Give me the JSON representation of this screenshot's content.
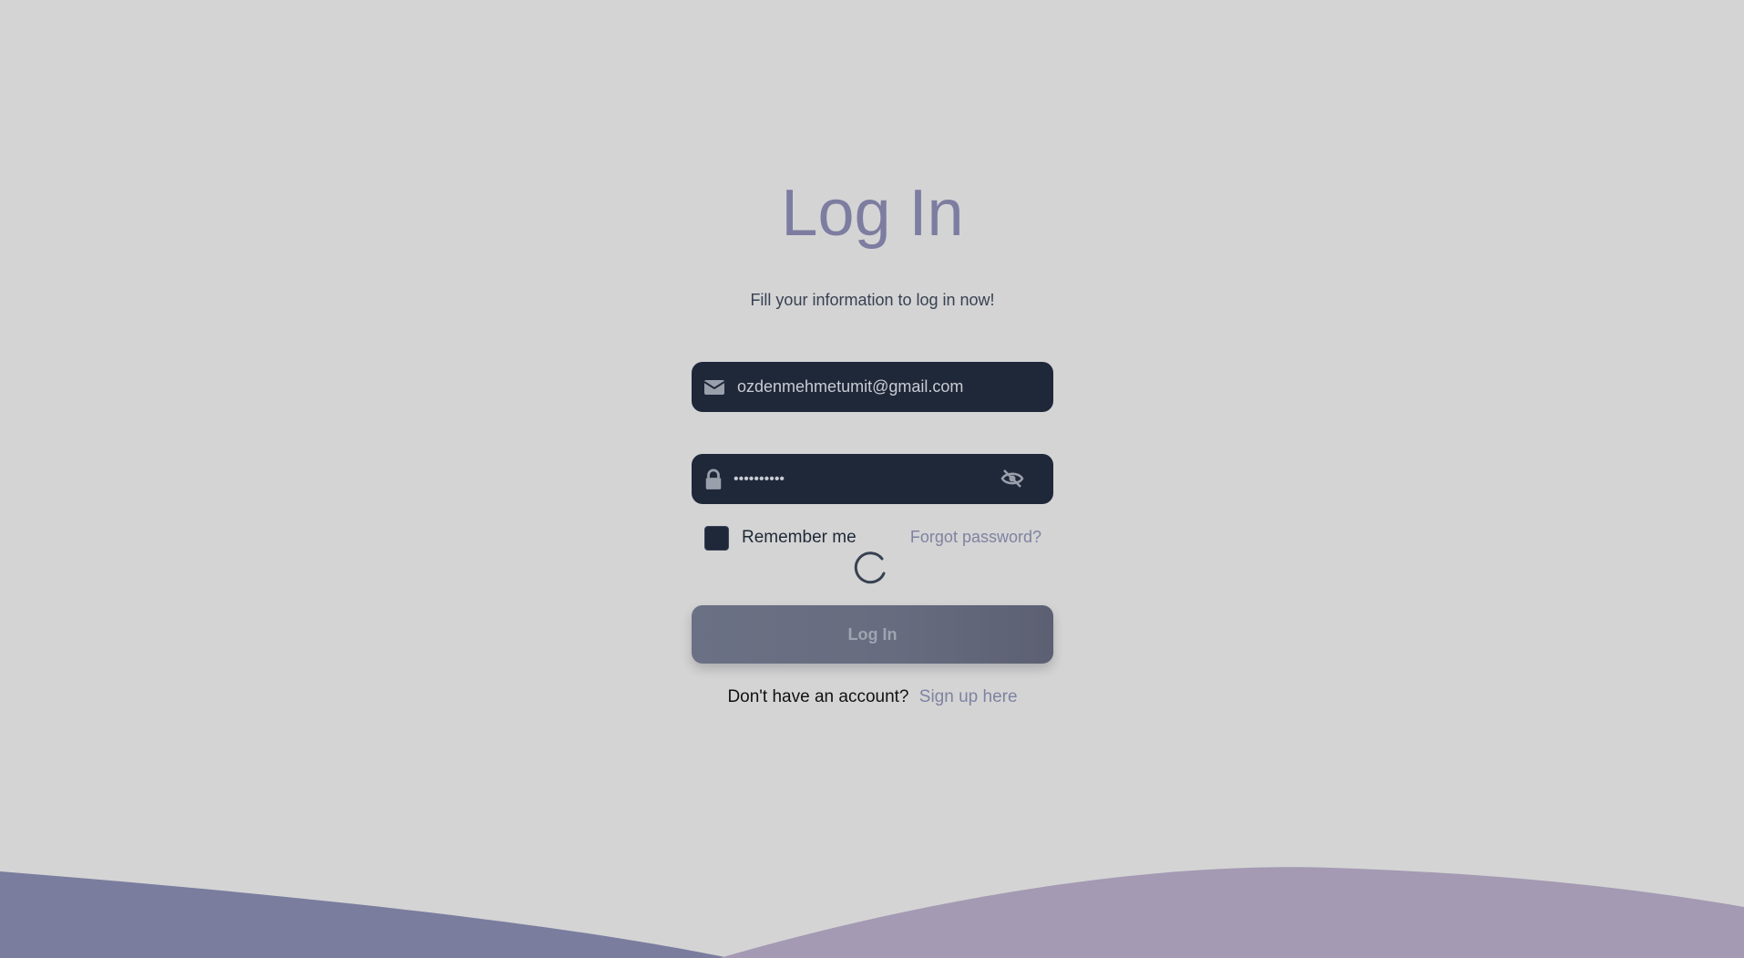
{
  "page": {
    "title": "Log In",
    "subtitle": "Fill your information to log in now!"
  },
  "email": {
    "icon": "envelope-icon",
    "value": "ozdenmehmetumit@gmail.com"
  },
  "password": {
    "icon": "lock-icon",
    "value": "••••••••••",
    "toggle_icon": "eye-slash-icon"
  },
  "options": {
    "remember_label": "Remember me",
    "remember_checked": false,
    "forgot_label": "Forgot password?"
  },
  "loading": {
    "icon": "spinner-icon"
  },
  "submit": {
    "label": "Log In"
  },
  "signup": {
    "question": "Don't have an account?",
    "link_label": "Sign up here"
  },
  "colors": {
    "background": "#d4d4d5",
    "title": "#7d7da1",
    "field_bg": "#1f2839",
    "wave_left": "#7b7d9e",
    "wave_right": "#a49ab3",
    "link": "#7e83a0"
  }
}
